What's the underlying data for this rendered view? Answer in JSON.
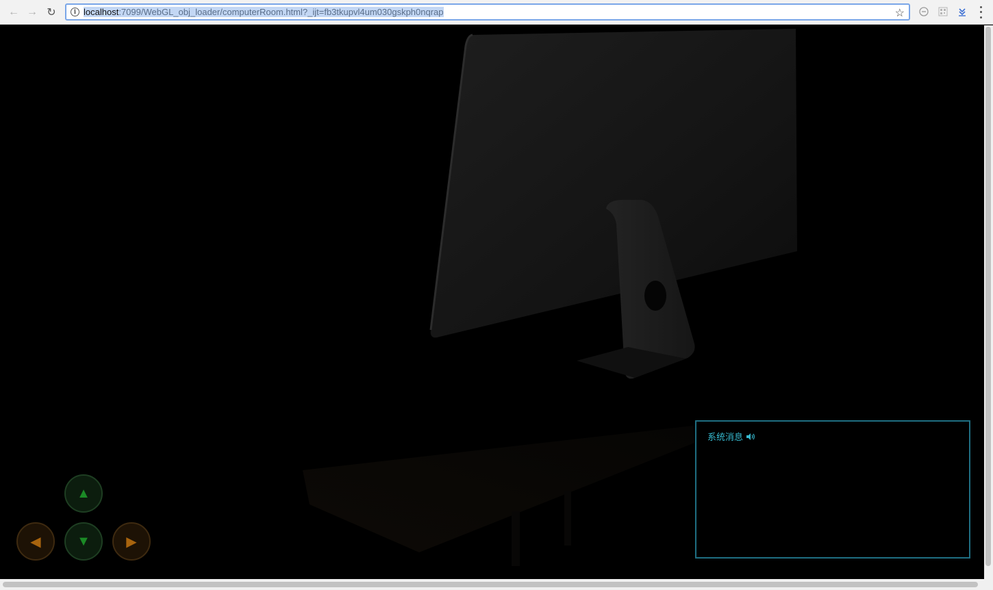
{
  "browser": {
    "url_host": "localhost",
    "url_path": ":7099/WebGL_obj_loader/computerRoom.html?_ijt=fb3tkupvl4um030gskph0nqrap",
    "nav": {
      "back": "←",
      "forward": "→",
      "reload": "↻"
    },
    "bookmark_icon": "☆"
  },
  "message_panel": {
    "title": "系统消息",
    "speaker_icon": "speaker-icon"
  },
  "controls": {
    "up": "▲",
    "down": "▼",
    "left": "◀",
    "right": "▶"
  },
  "colors": {
    "panel_border": "#1f6e82",
    "panel_title": "#36b9cf",
    "green_arrow": "#1b8a26",
    "orange_arrow": "#a8640e"
  }
}
